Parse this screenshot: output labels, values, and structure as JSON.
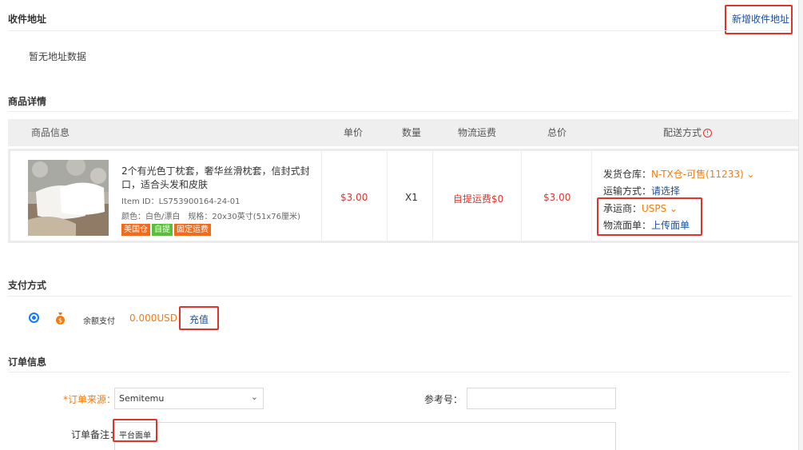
{
  "address": {
    "title": "收件地址",
    "add_link": "新增收件地址",
    "empty_text": "暂无地址数据"
  },
  "goods": {
    "title": "商品详情",
    "headers": {
      "info": "商品信息",
      "price": "单价",
      "qty": "数量",
      "freight": "物流运费",
      "total": "总价",
      "delivery": "配送方式"
    },
    "item": {
      "name": "2个有光色丁枕套，奢华丝滑枕套，信封式封口，适合头发和皮肤",
      "item_id": "Item ID：LS753900164-24-01",
      "specs": "颜色：白色/漂白　规格：20x30英寸(51x76厘米)",
      "tags": [
        "美国仓",
        "自提",
        "固定运费"
      ],
      "price": "$3.00",
      "qty": "X1",
      "freight": "自提运费$0",
      "total": "$3.00",
      "warehouse_label": "发货仓库：",
      "warehouse_value": "N-TX仓-可售(11233)",
      "transport_label": "运输方式：",
      "transport_value": "请选择",
      "carrier_label": "承运商：",
      "carrier_value": "USPS",
      "label_label": "物流面单：",
      "label_value": "上传面单"
    }
  },
  "payment": {
    "title": "支付方式",
    "method_label": "余额支付",
    "balance": "0.000USD",
    "recharge": "充值"
  },
  "order": {
    "title": "订单信息",
    "source_label": "订单来源：",
    "source_value": "Semitemu",
    "ref_label": "参考号：",
    "ref_value": "",
    "remark_label": "订单备注：",
    "remark_value": "平台面单"
  },
  "colors": {
    "accent_blue": "#1a4fa0",
    "price_red": "#e0332b",
    "orange": "#f07c10",
    "tag_orange": "#f26a1b",
    "tag_green": "#5cbd3c",
    "highlight_box": "#e0332b"
  }
}
